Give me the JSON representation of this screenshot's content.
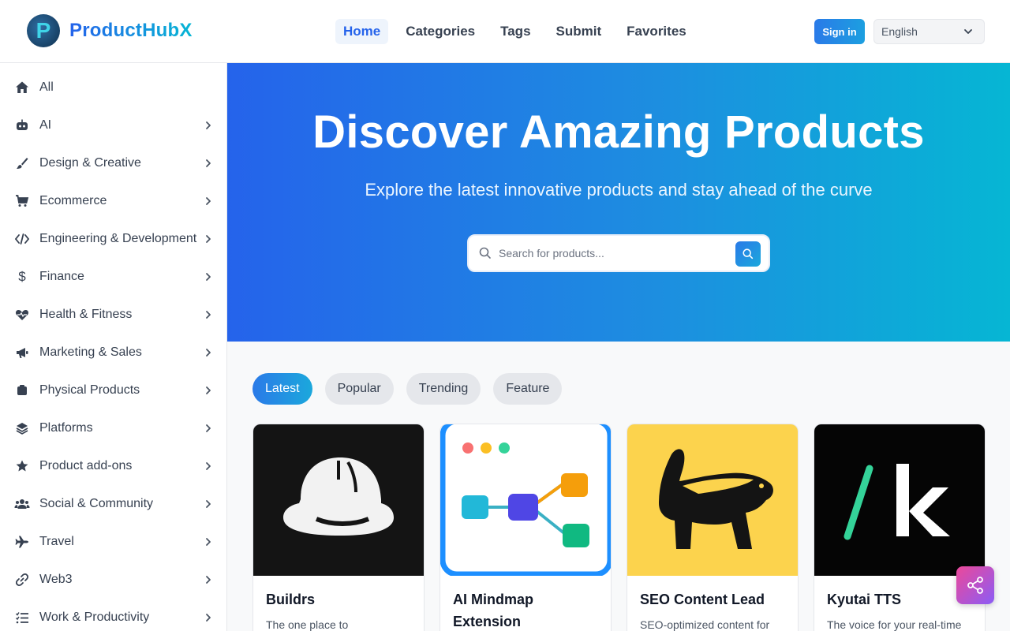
{
  "app": {
    "name": "ProductHubX",
    "logo_letter": "P"
  },
  "nav": {
    "items": [
      {
        "label": "Home",
        "active": true
      },
      {
        "label": "Categories"
      },
      {
        "label": "Tags"
      },
      {
        "label": "Submit"
      },
      {
        "label": "Favorites"
      }
    ]
  },
  "header": {
    "signin_label": "Sign in",
    "language": "English"
  },
  "sidebar": {
    "items": [
      {
        "label": "All",
        "icon": "home-icon"
      },
      {
        "label": "AI",
        "icon": "robot-icon"
      },
      {
        "label": "Design & Creative",
        "icon": "brush-icon"
      },
      {
        "label": "Ecommerce",
        "icon": "cart-icon"
      },
      {
        "label": "Engineering & Development",
        "icon": "code-icon"
      },
      {
        "label": "Finance",
        "icon": "dollar-icon"
      },
      {
        "label": "Health & Fitness",
        "icon": "heartbeat-icon"
      },
      {
        "label": "Marketing & Sales",
        "icon": "megaphone-icon"
      },
      {
        "label": "Physical Products",
        "icon": "box-icon"
      },
      {
        "label": "Platforms",
        "icon": "layers-icon"
      },
      {
        "label": "Product add-ons",
        "icon": "star-icon"
      },
      {
        "label": "Social & Community",
        "icon": "users-icon"
      },
      {
        "label": "Travel",
        "icon": "plane-icon"
      },
      {
        "label": "Web3",
        "icon": "link-icon"
      },
      {
        "label": "Work & Productivity",
        "icon": "list-icon"
      }
    ]
  },
  "hero": {
    "title": "Discover Amazing Products",
    "subtitle": "Explore the latest innovative products and stay ahead of the curve",
    "search_placeholder": "Search for products..."
  },
  "tabs": [
    {
      "label": "Latest",
      "active": true
    },
    {
      "label": "Popular"
    },
    {
      "label": "Trending"
    },
    {
      "label": "Feature"
    }
  ],
  "cards": [
    {
      "title": "Buildrs",
      "description": "The one place to"
    },
    {
      "title": "AI Mindmap Extension",
      "description": ""
    },
    {
      "title": "SEO Content Lead",
      "description": "SEO-optimized content for"
    },
    {
      "title": "Kyutai TTS",
      "description": "The voice for your real-time"
    }
  ],
  "colors": {
    "brand_blue": "#2563eb",
    "brand_cyan": "#06b6d4",
    "share_pink": "#ec4899",
    "share_purple": "#8b5cf6"
  }
}
